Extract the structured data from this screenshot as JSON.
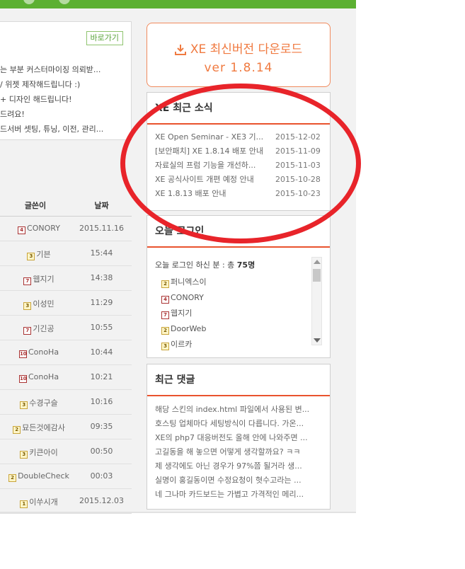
{
  "left_box": {
    "goto_label": "바로가기",
    "lines": [
      "는 부분 커스터마이징 의뢰받...",
      "/ 위젯 제작해드립니다 :)",
      "+ 디자인 해드립니다!",
      "드려요!",
      "드서버 셋팅, 튜닝, 이전, 관리..."
    ]
  },
  "table": {
    "headers": {
      "author": "글쓴이",
      "date": "날짜"
    },
    "rows": [
      {
        "level": "4",
        "level_style": "red",
        "author": "CONORY",
        "date": "2015.11.16"
      },
      {
        "level": "3",
        "level_style": "yellow",
        "author": "기븐",
        "date": "15:44"
      },
      {
        "level": "7",
        "level_style": "red",
        "author": "웹지기",
        "date": "14:38"
      },
      {
        "level": "3",
        "level_style": "yellow",
        "author": "이성민",
        "date": "11:29"
      },
      {
        "level": "7",
        "level_style": "red",
        "author": "기긴공",
        "date": "10:55"
      },
      {
        "level": "10",
        "level_style": "red",
        "author": "ConoHa",
        "date": "10:44"
      },
      {
        "level": "10",
        "level_style": "red",
        "author": "ConoHa",
        "date": "10:21"
      },
      {
        "level": "3",
        "level_style": "yellow",
        "author": "수경구슬",
        "date": "10:16"
      },
      {
        "level": "2",
        "level_style": "yellow",
        "author": "묘든것에감사",
        "date": "09:35"
      },
      {
        "level": "3",
        "level_style": "yellow",
        "author": "키큰아이",
        "date": "00:50"
      },
      {
        "level": "2",
        "level_style": "yellow",
        "author": "DoubleCheck",
        "date": "00:03"
      },
      {
        "level": "1",
        "level_style": "yellow",
        "author": "이쑤시개",
        "date": "2015.12.03"
      }
    ]
  },
  "download": {
    "label": "XE 최신버전 다운로드",
    "version": "ver 1.8.14",
    "icon": "download-icon"
  },
  "news": {
    "title": "XE 최근 소식",
    "items": [
      {
        "title": "XE Open Seminar - XE3 기...",
        "date": "2015-12-02"
      },
      {
        "title": "[보안패치] XE 1.8.14 배포 안내",
        "date": "2015-11-09"
      },
      {
        "title": "자료실의 프럼 기능을 개선하...",
        "date": "2015-11-03"
      },
      {
        "title": "XE 공식사이트 개편 예정 안내",
        "date": "2015-10-28"
      },
      {
        "title": "XE 1.8.13 배포 안내",
        "date": "2015-10-23"
      }
    ]
  },
  "login": {
    "title": "오늘 로그인",
    "summary_prefix": "오늘 로그인 하신 분 : 총 ",
    "summary_count": "75명",
    "users": [
      {
        "level": "2",
        "name": "퍼니엑스이"
      },
      {
        "level": "4",
        "name": "CONORY"
      },
      {
        "level": "7",
        "name": "웹지기"
      },
      {
        "level": "2",
        "name": "DoorWeb"
      },
      {
        "level": "3",
        "name": "이르카"
      }
    ]
  },
  "comments": {
    "title": "최근 댓글",
    "items": [
      "해당 스킨의 index.html 파일에서 사용된 변...",
      "호스팅 업체마다 세팅방식이 다릅니다. 가온...",
      "XE의 php7 대응버전도 올해 안에 나와주면 ...",
      "고길동을 해 놓으면 어떻게 생각할까요? ㅋㅋ",
      "제 생각에도 아닌 경우가 97%쯤 될거라 생...",
      "실명이 홍길동이면 수정요청이 혓수고라는 ...",
      "네 그나마 카드보드는 가볍고 가격적인 메리..."
    ]
  },
  "colors": {
    "top_bar": "#5cb032",
    "accent": "#e9532e",
    "download": "#f07a40",
    "annotation": "#e8242a"
  }
}
